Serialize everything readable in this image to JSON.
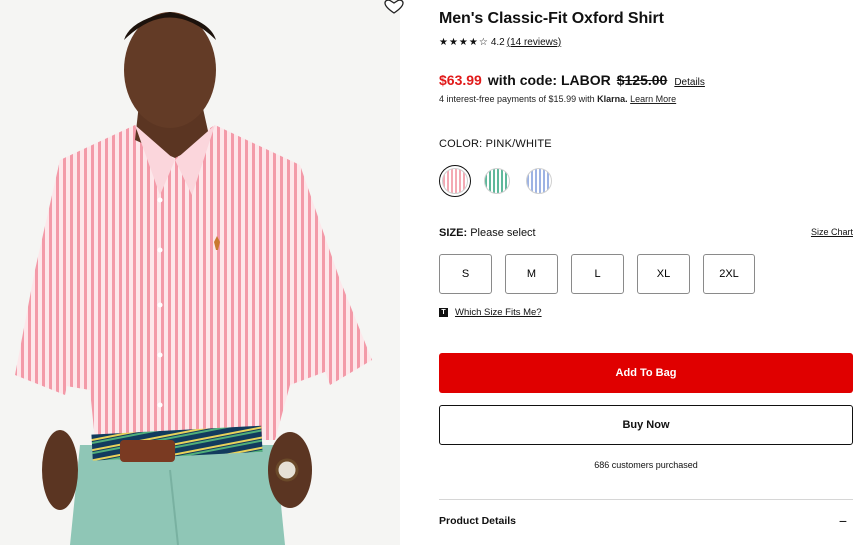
{
  "product": {
    "title": "Men's Classic-Fit Oxford Shirt",
    "stars_display": "★★★★☆",
    "rating": "4.2",
    "reviews_label": "(14 reviews)",
    "rating_value": 4.2
  },
  "pricing": {
    "sale_price": "$63.99",
    "code_text": "with code: LABOR",
    "original_price": "$125.00",
    "details_link": "Details",
    "sale_color": "#e11a1a"
  },
  "klarna": {
    "prefix": "4 interest-free payments of $15.99 with",
    "brand": "Klarna.",
    "learn_more": "Learn More"
  },
  "color": {
    "label": "COLOR: PINK/WHITE",
    "swatches": [
      {
        "name": "pink-white",
        "hex": "#f4a9b4",
        "selected": true
      },
      {
        "name": "green-white",
        "hex": "#5fb89b",
        "selected": false
      },
      {
        "name": "blue-white",
        "hex": "#9db3e4",
        "selected": false
      }
    ]
  },
  "size": {
    "label": "SIZE:",
    "prompt": "Please select",
    "chart_link": "Size Chart",
    "options": [
      "S",
      "M",
      "L",
      "XL",
      "2XL"
    ],
    "fit_icon": "T",
    "fit_link": "Which Size Fits Me?"
  },
  "actions": {
    "add_to_bag": "Add To Bag",
    "buy_now": "Buy Now",
    "add_color": "#e00000"
  },
  "social_proof": "686 customers purchased",
  "accordion": {
    "product_details": "Product Details",
    "toggle": "−"
  },
  "icons": {
    "wishlist": "heart-icon"
  }
}
